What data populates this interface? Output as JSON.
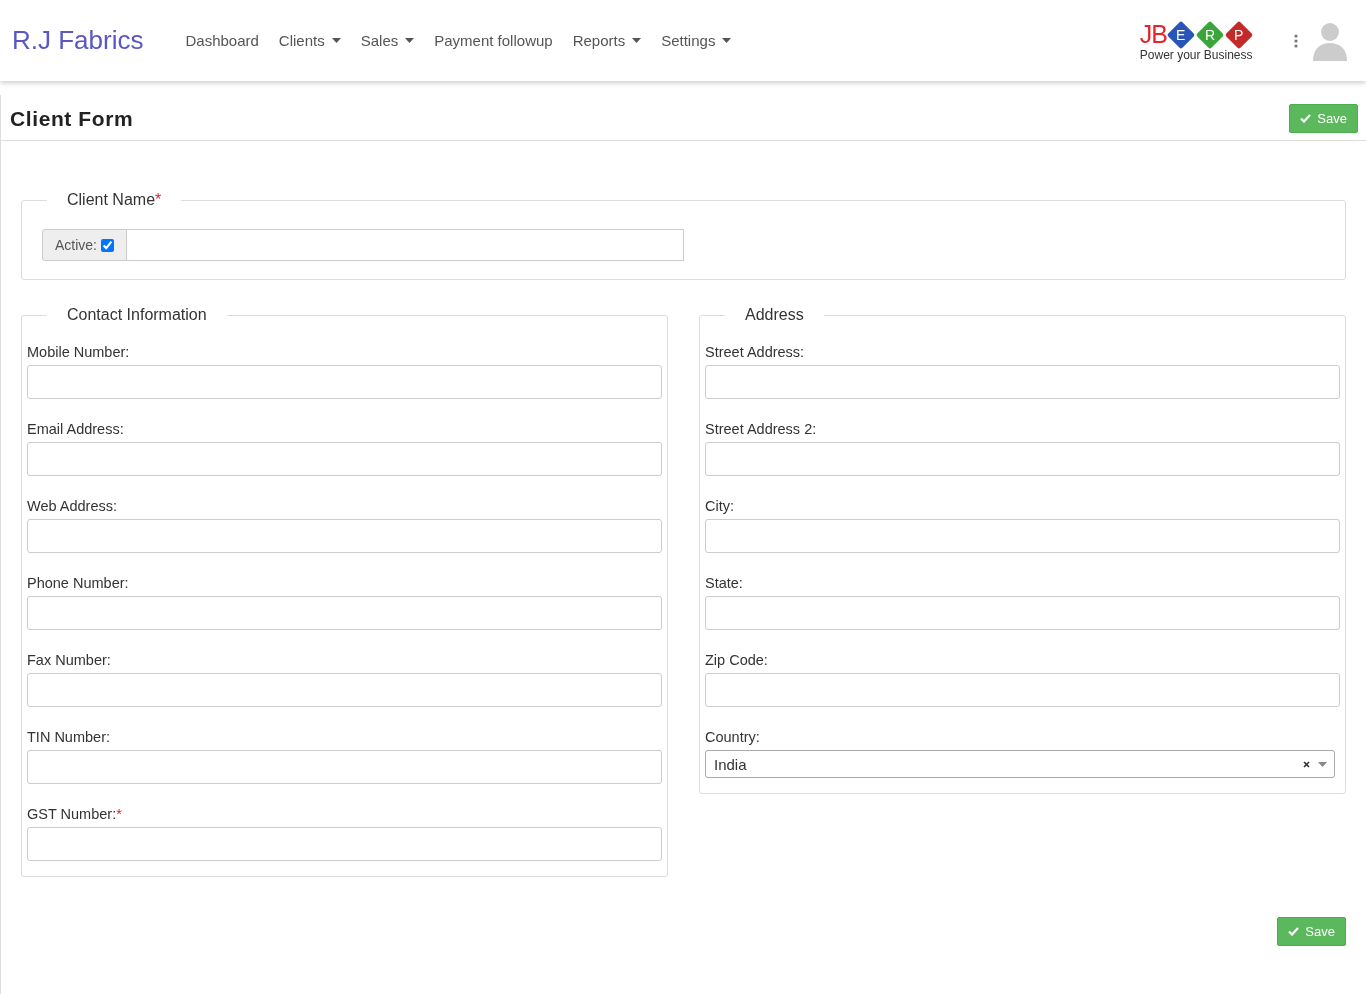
{
  "brand": "R.J Fabrics",
  "nav": [
    {
      "label": "Dashboard",
      "has_menu": false
    },
    {
      "label": "Clients",
      "has_menu": true
    },
    {
      "label": "Sales",
      "has_menu": true
    },
    {
      "label": "Payment followup",
      "has_menu": false
    },
    {
      "label": "Reports",
      "has_menu": true
    },
    {
      "label": "Settings",
      "has_menu": true
    }
  ],
  "logo": {
    "prefix": "JB",
    "tiles": [
      {
        "letter": "E",
        "color": "#2a55b8"
      },
      {
        "letter": "R",
        "color": "#3aa53a"
      },
      {
        "letter": "P",
        "color": "#c42a2a"
      }
    ],
    "tagline": "Power your Business"
  },
  "page_title": "Client Form",
  "top_save": {
    "label": "Save"
  },
  "client_name": {
    "legend": "Client Name",
    "required_mark": "*",
    "active_label": "Active:",
    "active_checked": true
  },
  "sections": [
    {
      "legend": "Contact Information",
      "fields": [
        {
          "kind": "text",
          "label": "Mobile Number:"
        },
        {
          "kind": "text",
          "label": "Email Address:"
        },
        {
          "kind": "text",
          "label": "Web Address:"
        },
        {
          "kind": "text",
          "label": "Phone Number:"
        },
        {
          "kind": "text",
          "label": "Fax Number:"
        },
        {
          "kind": "text",
          "label": "TIN Number:"
        },
        {
          "kind": "text",
          "label": "GST Number:",
          "required_mark": "*"
        }
      ]
    },
    {
      "legend": "Address",
      "fields": [
        {
          "kind": "text",
          "label": "Street Address:"
        },
        {
          "kind": "text",
          "label": "Street Address 2:"
        },
        {
          "kind": "text",
          "label": "City:"
        },
        {
          "kind": "text",
          "label": "State:"
        },
        {
          "kind": "text",
          "label": "Zip Code:"
        },
        {
          "kind": "select",
          "label": "Country:",
          "value": "India"
        }
      ]
    }
  ],
  "bottom_save": {
    "label": "Save"
  }
}
